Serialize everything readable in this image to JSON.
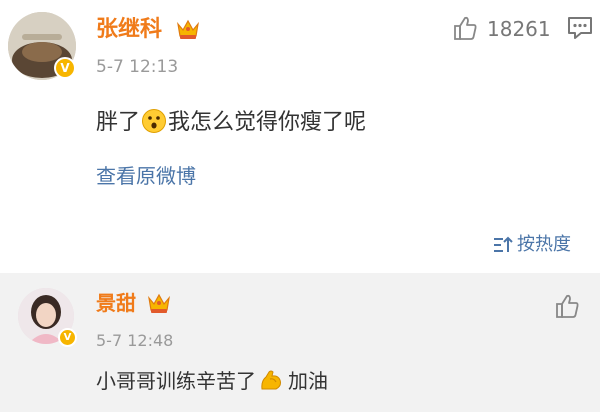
{
  "top_comment": {
    "username": "张继科",
    "time": "5-7 12:13",
    "like_count": "18261",
    "text_before": "胖了",
    "text_after": "我怎么觉得你瘦了呢",
    "view_original": "查看原微博"
  },
  "sort": {
    "label": "按热度"
  },
  "reply": {
    "username": "景甜",
    "time": "5-7 12:48",
    "text_before": "小哥哥训练辛苦了",
    "text_after": "加油"
  },
  "colors": {
    "username": "#f07b1a",
    "link": "#4b75a8",
    "badge": "#f7b500",
    "reply_background": "#f2f2f2"
  },
  "icons": [
    "crown-icon",
    "thumb-up-icon",
    "comment-icon",
    "surprised-emoji-icon",
    "sort-icon",
    "flexed-bicep-emoji-icon",
    "verified-badge-icon"
  ]
}
